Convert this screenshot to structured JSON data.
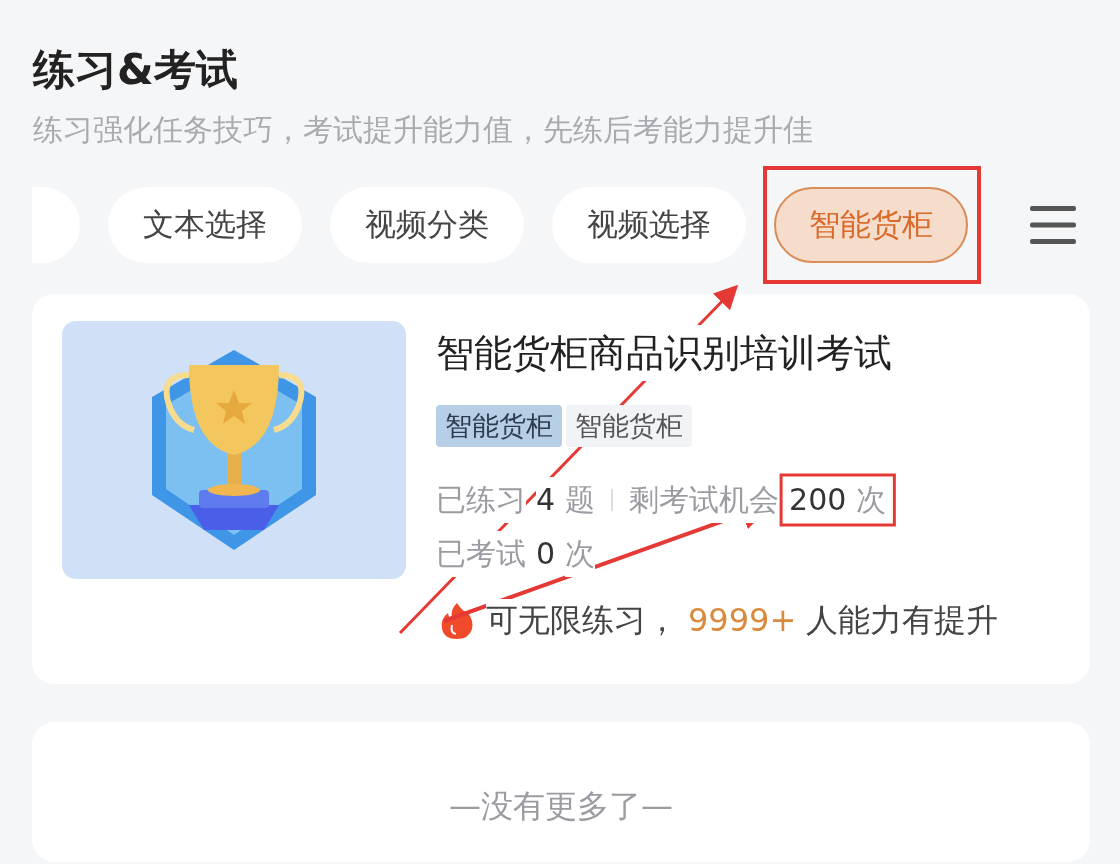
{
  "header": {
    "title": "练习&考试",
    "subtitle": "练习强化任务技巧，考试提升能力值，先练后考能力提升佳"
  },
  "tabs": [
    {
      "label": "文本选择",
      "selected": false
    },
    {
      "label": "视频分类",
      "selected": false
    },
    {
      "label": "视频选择",
      "selected": false
    },
    {
      "label": "智能货柜",
      "selected": true
    }
  ],
  "card": {
    "title": "智能货柜商品识别培训考试",
    "tags": [
      {
        "label": "智能货柜",
        "kind": "primary"
      },
      {
        "label": "智能货柜",
        "kind": "plain"
      }
    ],
    "stats": [
      {
        "label": "已练习",
        "value": "4",
        "unit": "题"
      },
      {
        "label": "剩考试机会",
        "value": "200",
        "unit": "次"
      },
      {
        "label": "已考试",
        "value": "0",
        "unit": "次"
      }
    ],
    "footer": {
      "prefix": "可无限练习，",
      "count": "9999+",
      "suffix": "人能力有提升"
    }
  },
  "end_note": "—没有更多了—"
}
